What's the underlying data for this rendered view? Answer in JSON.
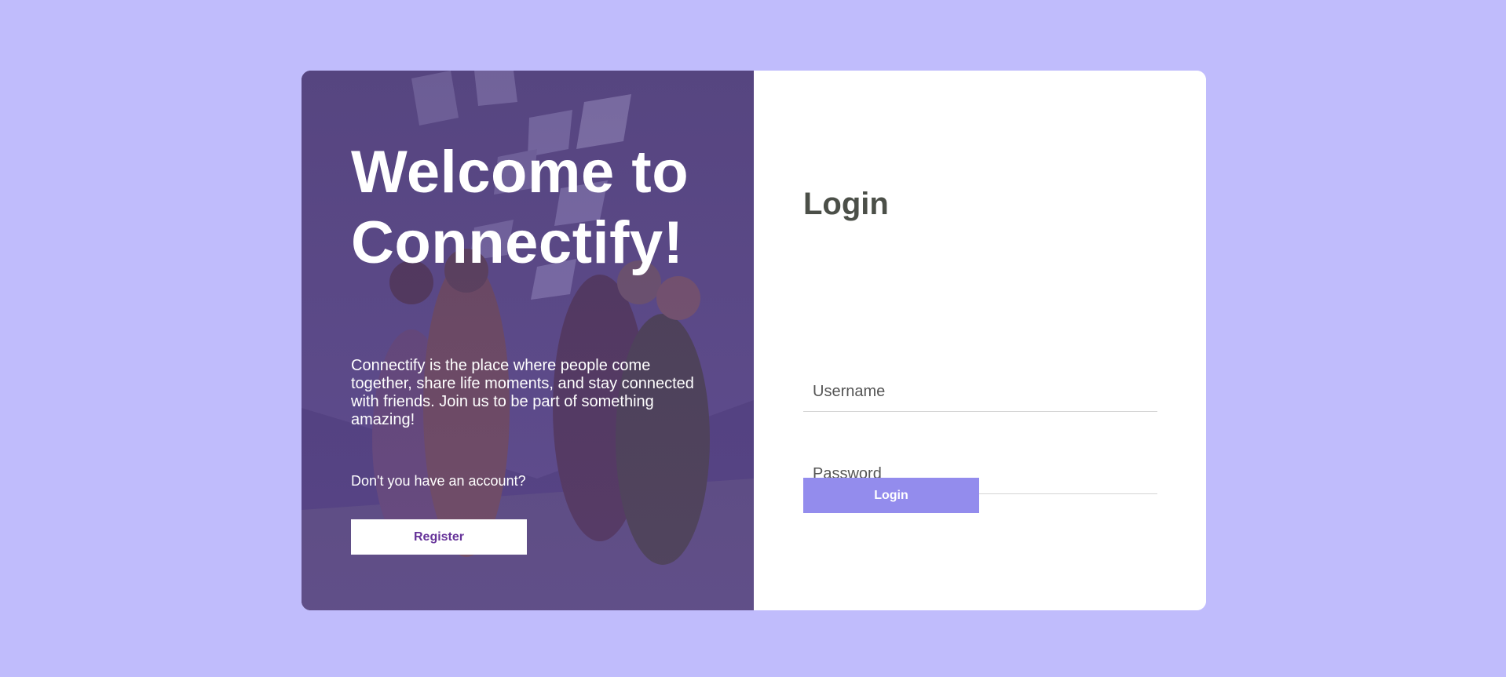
{
  "colors": {
    "background": "#c0bcfc",
    "card": "#ffffff",
    "overlay": "#4a3d6e",
    "login_button": "#938ced",
    "register_text": "#663399",
    "title_text": "#4b4f48"
  },
  "hero": {
    "image": "group-of-friends-cheering-photo",
    "title": "Welcome to Connectify!",
    "description": "Connectify is the place where people come together, share life moments, and stay connected with friends. Join us to be part of something amazing!",
    "no_account_text": "Don't you have an account?",
    "register_label": "Register"
  },
  "login": {
    "title": "Login",
    "username_placeholder": "Username",
    "password_placeholder": "Password",
    "button_label": "Login"
  }
}
